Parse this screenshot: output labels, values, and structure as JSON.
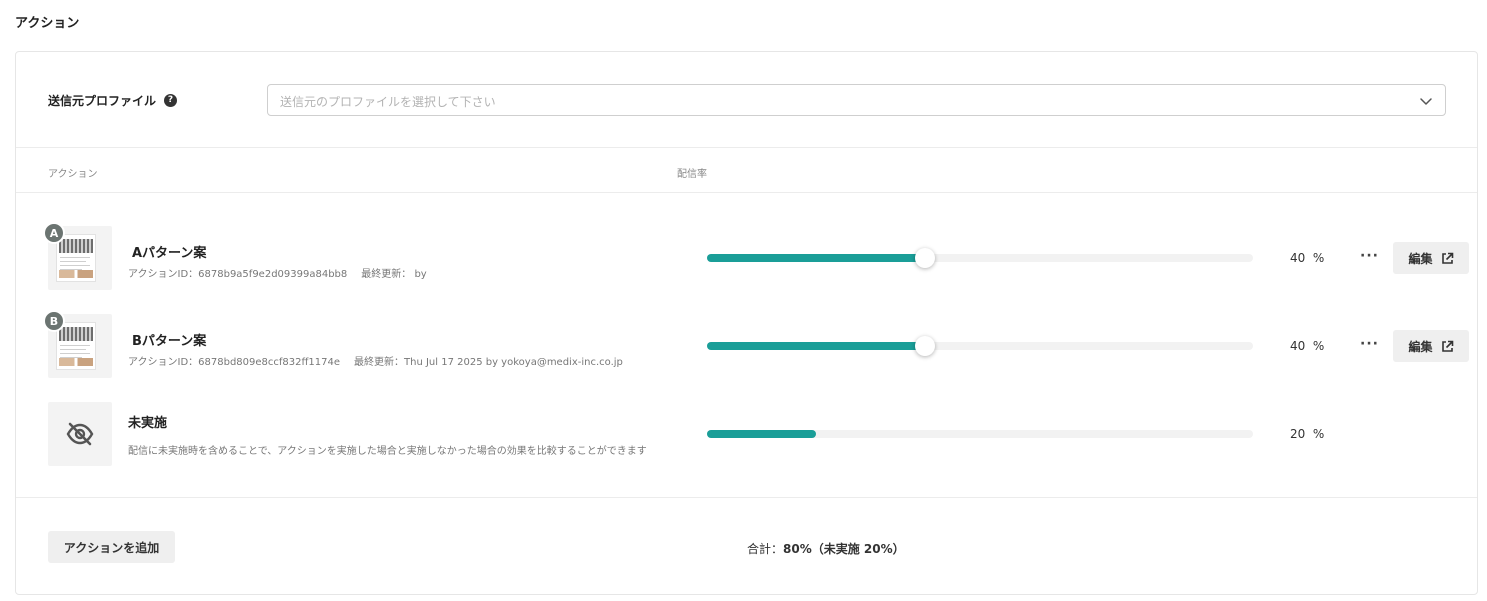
{
  "section_title": "アクション",
  "profile": {
    "label": "送信元プロファイル",
    "help_glyph": "?",
    "placeholder": "送信元のプロファイルを選択して下さい"
  },
  "table": {
    "col_action": "アクション",
    "col_rate": "配信率"
  },
  "rows": [
    {
      "badge": "A",
      "title": "Aパターン案",
      "meta_id": "アクションID：6878b9a5f9e2d09399a84bb8",
      "meta_updated": "最終更新： by",
      "rate": 40,
      "rate_label": "40",
      "pct_sign": "%",
      "more": "···",
      "edit_label": "編集"
    },
    {
      "badge": "B",
      "title": "Bパターン案",
      "meta_id": "アクションID：6878bd809e8ccf832ff1174e",
      "meta_updated": "最終更新：Thu Jul 17 2025 by yokoya@medix-inc.co.jp",
      "rate": 40,
      "rate_label": "40",
      "pct_sign": "%",
      "more": "···",
      "edit_label": "編集"
    }
  ],
  "no_action": {
    "title": "未実施",
    "description": "配信に未実施時を含めることで、アクションを実施した場合と実施しなかった場合の効果を比較することができます",
    "rate": 20,
    "rate_label": "20",
    "pct_sign": "%"
  },
  "footer": {
    "add_label": "アクションを追加",
    "total_prefix": "合計：",
    "total_value": "80%（未実施 20%）"
  },
  "colors": {
    "accent": "#1a9e98",
    "badge": "#6b7471"
  }
}
